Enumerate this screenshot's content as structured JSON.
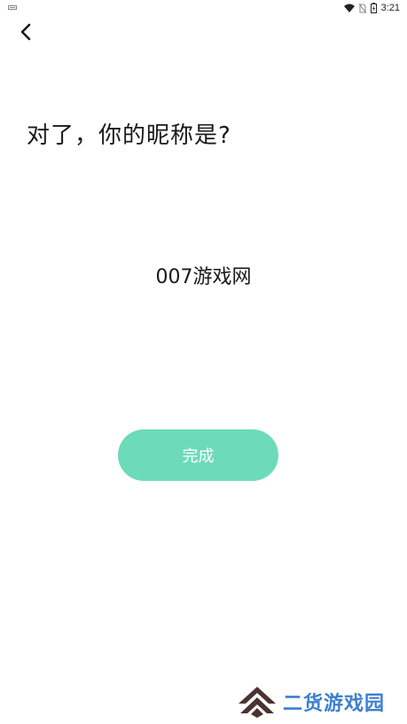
{
  "status_bar": {
    "time": "3:21",
    "icons": [
      "keyboard-icon",
      "wifi-icon",
      "no-sim-icon",
      "battery-charging-icon"
    ]
  },
  "header": {
    "back_icon": "chevron-left-icon"
  },
  "main": {
    "title": "对了，你的昵称是?",
    "nickname_value": "007游戏网",
    "done_label": "完成"
  },
  "watermark": {
    "text": "二货游戏园",
    "logo": "double-chevron-up-logo"
  },
  "colors": {
    "accent": "#6ddbb8",
    "text": "#1a1a1a",
    "watermark_text": "#3d7fd1",
    "watermark_logo": "#4a3330"
  }
}
